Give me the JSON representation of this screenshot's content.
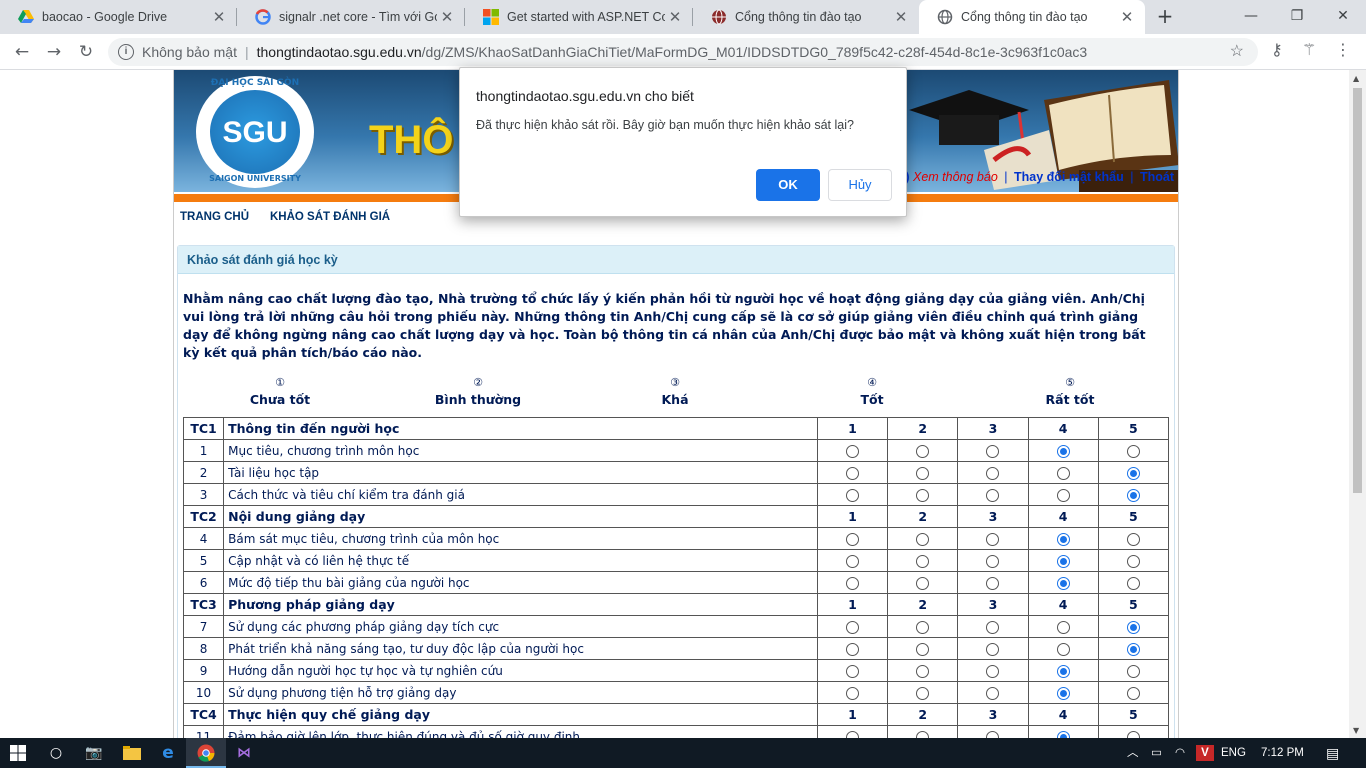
{
  "browser": {
    "tabs": [
      {
        "title": "baocao - Google Drive",
        "icon": "google-drive-icon",
        "active": false
      },
      {
        "title": "signalr .net core - Tìm với Goo",
        "icon": "google-icon",
        "active": false
      },
      {
        "title": "Get started with ASP.NET Core",
        "icon": "microsoft-icon",
        "active": false
      },
      {
        "title": "Cổng thông tin đào tạo",
        "icon": "globe-icon",
        "active": false
      },
      {
        "title": "Cổng thông tin đào tạo",
        "icon": "globe-icon",
        "active": true
      }
    ],
    "new_tab": "+",
    "address": {
      "security_label": "Không bảo mật",
      "host": "thongtindaotao.sgu.edu.vn",
      "path": "/dg/ZMS/KhaoSatDanhGiaChiTiet/MaFormDG_M01/IDDSDTDG0_789f5c42-c28f-454d-8c1e-3c963f1c0ac3"
    }
  },
  "site": {
    "logo": {
      "top_text": "ĐẠI HỌC SÀI GÒN",
      "main": "SGU",
      "bottom_text": "SAIGON UNIVERSITY"
    },
    "banner_title": "THÔ",
    "user_nav": {
      "bell": "4)",
      "notify": "Xem thông báo",
      "change_password": "Thay đổi mật khẩu",
      "logout": "Thoát"
    },
    "menu": [
      "TRANG CHỦ",
      "KHẢO SÁT ĐÁNH GIÁ"
    ]
  },
  "survey": {
    "heading": "Khảo sát đánh giá học kỳ",
    "intro": "Nhằm nâng cao chất lượng đào tạo, Nhà trường tổ chức lấy ý kiến phản hồi từ người học về hoạt động giảng dạy của giảng viên. Anh/Chị vui lòng trả lời những câu hỏi trong phiếu này. Những thông tin Anh/Chị cung cấp sẽ là cơ sở giúp giảng viên điều chỉnh quá trình giảng dạy để không ngừng nâng cao chất lượng dạy và học. Toàn bộ thông tin cá nhân của Anh/Chị được bảo mật và không xuất hiện trong bất kỳ kết quả phân tích/báo cáo nào.",
    "scale": [
      {
        "num": "①",
        "label": "Chưa tốt"
      },
      {
        "num": "②",
        "label": "Bình thường"
      },
      {
        "num": "③",
        "label": "Khá"
      },
      {
        "num": "④",
        "label": "Tốt"
      },
      {
        "num": "⑤",
        "label": "Rất tốt"
      }
    ],
    "option_labels": [
      "1",
      "2",
      "3",
      "4",
      "5"
    ],
    "groups": [
      {
        "code": "TC1",
        "title": "Thông tin đến người học",
        "items": [
          {
            "no": "1",
            "text": "Mục tiêu, chương trình môn học",
            "selected": 4
          },
          {
            "no": "2",
            "text": "Tài liệu học tập",
            "selected": 5
          },
          {
            "no": "3",
            "text": "Cách thức và tiêu chí kiểm tra đánh giá",
            "selected": 5
          }
        ]
      },
      {
        "code": "TC2",
        "title": "Nội dung giảng dạy",
        "items": [
          {
            "no": "4",
            "text": "Bám sát mục tiêu, chương trình của môn học",
            "selected": 4
          },
          {
            "no": "5",
            "text": "Cập nhật và có liên hệ thực tế",
            "selected": 4
          },
          {
            "no": "6",
            "text": "Mức độ tiếp thu bài giảng của người học",
            "selected": 4
          }
        ]
      },
      {
        "code": "TC3",
        "title": "Phương pháp giảng dạy",
        "items": [
          {
            "no": "7",
            "text": "Sử dụng các phương pháp giảng dạy tích cực",
            "selected": 5
          },
          {
            "no": "8",
            "text": "Phát triển khả năng sáng tạo, tư duy độc lập của người học",
            "selected": 5
          },
          {
            "no": "9",
            "text": "Hướng dẫn người học tự học và tự nghiên cứu",
            "selected": 4
          },
          {
            "no": "10",
            "text": "Sử dụng phương tiện hỗ trợ giảng dạy",
            "selected": 4
          }
        ]
      },
      {
        "code": "TC4",
        "title": "Thực hiện quy chế giảng dạy",
        "items": [
          {
            "no": "11",
            "text": "Đảm bảo giờ lên lớp, thực hiện đúng và đủ số giờ quy định",
            "selected": 4
          }
        ]
      }
    ]
  },
  "dialog": {
    "title": "thongtindaotao.sgu.edu.vn cho biết",
    "message": "Đã thực hiện khảo sát rồi. Bây giờ bạn muốn thực hiện khảo sát lại?",
    "ok": "OK",
    "cancel": "Hủy"
  },
  "taskbar": {
    "language": "ENG",
    "time": "7:12 PM"
  },
  "colors": {
    "accent": "#1a73e8",
    "banner_orange": "#f57c0f",
    "banner_blue": "#3577ad",
    "link_red": "#e00000"
  }
}
